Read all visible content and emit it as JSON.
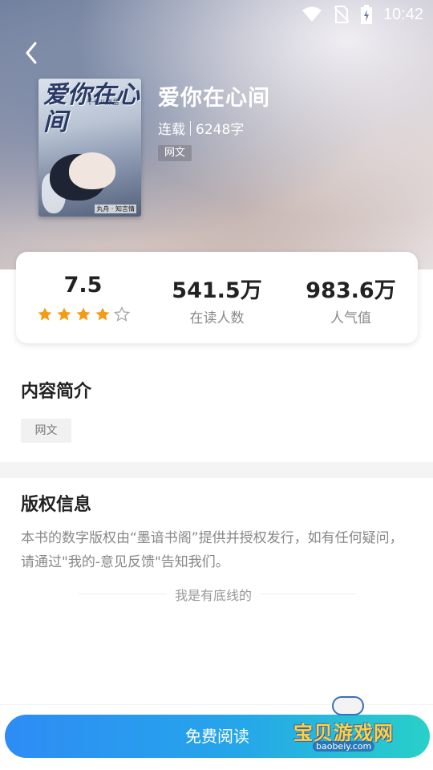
{
  "status_bar": {
    "time": "10:42"
  },
  "book": {
    "title": "爱你在心间",
    "status": "连载",
    "word_count": "6248字",
    "tag": "网文",
    "cover": {
      "title_text": "爱你在心间",
      "subtitle": "千七八作品",
      "author_text": "丸舟 · 知言情"
    }
  },
  "stats": {
    "rating": "7.5",
    "stars_filled": 4,
    "stars_total": 5,
    "readers": "541.5万",
    "readers_label": "在读人数",
    "popularity": "983.6万",
    "popularity_label": "人气值"
  },
  "intro": {
    "title": "内容简介",
    "tag": "网文"
  },
  "copyright": {
    "title": "版权信息",
    "text": "本书的数字版权由“墨谙书阁”提供并授权发行，如有任何疑问，请通过\"我的-意见反馈\"告知我们。"
  },
  "bottom_line": "我是有底线的",
  "read_button": "免费阅读",
  "watermark": {
    "title": "宝贝游戏网",
    "url": "baobeiy.com"
  },
  "colors": {
    "star": "#f39c12",
    "button_start": "#2e8cf5",
    "button_end": "#29d0c8"
  }
}
